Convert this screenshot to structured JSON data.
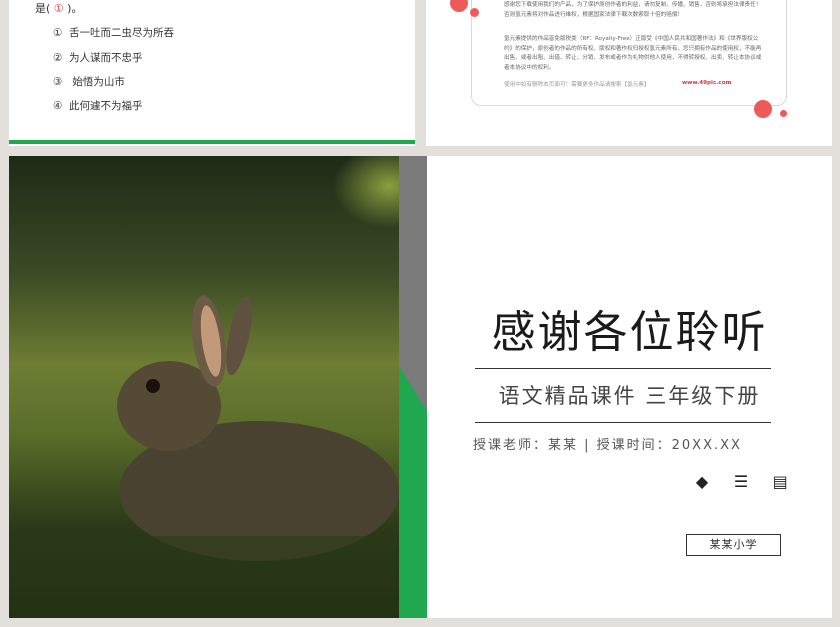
{
  "quiz": {
    "prefix": "是(",
    "answer_mark": "①",
    "suffix": ")。",
    "options": [
      {
        "num": "①",
        "text": "舌一吐而二虫尽为所吞"
      },
      {
        "num": "②",
        "text": "为人谋而不忠乎"
      },
      {
        "num": "③",
        "text": " 始悟为山市"
      },
      {
        "num": "④",
        "text": "此何遽不为福乎"
      }
    ]
  },
  "copyright": {
    "para1": "感谢您下载使用我们的产品，为了保护原创作者的利益，请勿复制、传播、销售，否则将承担法律责任！否则氢元素将对作品进行维权，根据国家法律下载次数索取十倍的赔偿！",
    "para2": "氢元素提供的作品皆免版税类（RF：Royalty-Free）正版受《中国人民共和国著作法》和《世界版权公约》的保护，原创者的作品的所有权、版权和著作权归授权氢元素所有，您只拥有作品的使用权，不能再出售、或者出租、出借、转让、分销、发布或者作为礼物供他人使用，不得转授权、出卖、转让本协议或者本协议中的权利。",
    "footer": "使用中如有删除本页面可！需要更多作品请搜索【氢元素】",
    "url": "www.49pic.com"
  },
  "title_slide": {
    "main_title": "感谢各位聆听",
    "subtitle": "语文精品课件  三年级下册",
    "info": "授课老师：某某  |  授课时间：20XX.XX",
    "icons": [
      "layers-icon",
      "coins-icon",
      "id-card-icon"
    ],
    "school": "某某小学"
  },
  "photo": {
    "subject": "rabbit-in-grass"
  },
  "colors": {
    "accent_green": "#1fa84f",
    "accent_red": "#ee5a5a"
  }
}
